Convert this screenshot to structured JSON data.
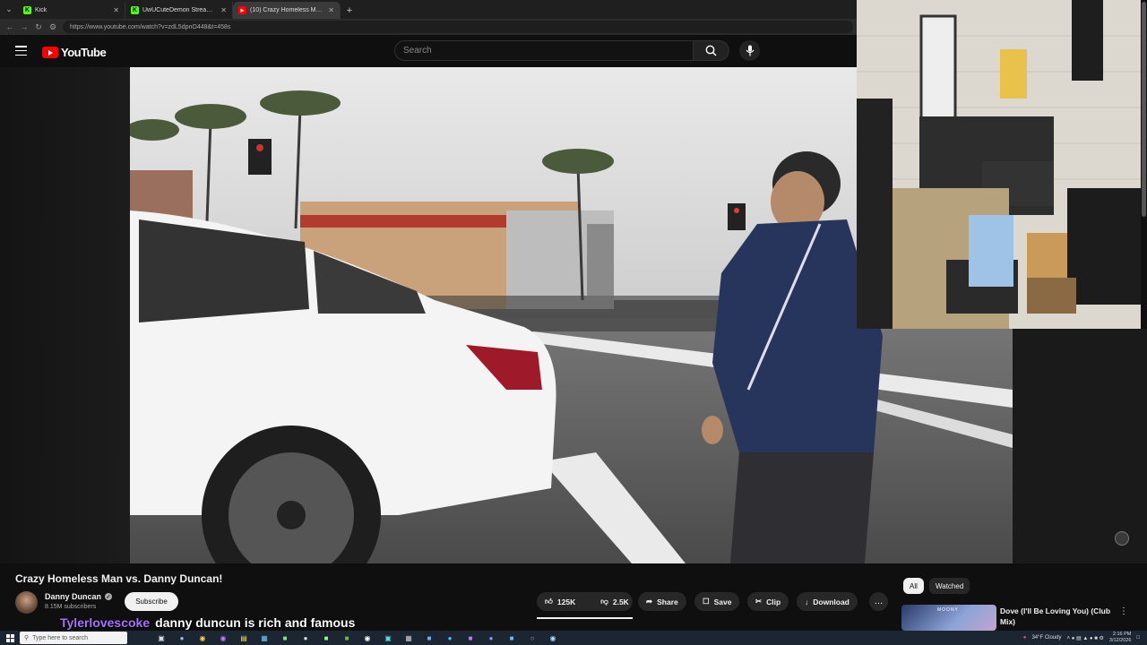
{
  "browser": {
    "tabs": [
      {
        "title": "Kick",
        "favicon": "K",
        "color": "#53fc18",
        "active": false
      },
      {
        "title": "UwUCuteDemon Stream - Watch L",
        "favicon": "K",
        "color": "#53fc18",
        "active": false
      },
      {
        "title": "(10) Crazy Homeless Man vs.",
        "favicon": "▶",
        "color": "#ff0000",
        "active": true
      }
    ],
    "url": "https://www.youtube.com/watch?v=zdL5dpnO448&t=458s"
  },
  "youtube": {
    "logo_text": "YouTube",
    "search_placeholder": "Search"
  },
  "video": {
    "title": "Crazy Homeless Man vs. Danny Duncan!",
    "channel": "Danny Duncan",
    "subscribers": "8.15M subscribers",
    "subscribe_label": "Subscribe",
    "likes": "125K",
    "dislikes": "2.5K",
    "share_label": "Share",
    "save_label": "Save",
    "clip_label": "Clip",
    "download_label": "Download"
  },
  "chips": {
    "all": "All",
    "watched": "Watched"
  },
  "recommendation": {
    "title": "Dove (I'll Be Loving You) (Club Mix)",
    "thumb_tag": "MOONY"
  },
  "chat_overlay": {
    "user": "Tylerlovescoke",
    "message": "danny duncun is rich and famous"
  },
  "taskbar": {
    "search_placeholder": "Type here to search",
    "weather": "34°F  Cloudy",
    "time": "2:16 PM",
    "date": "3/12/2026"
  },
  "colors": {
    "brand_red": "#ff0000",
    "chat_user": "#a970ff",
    "kick_green": "#53fc18"
  }
}
